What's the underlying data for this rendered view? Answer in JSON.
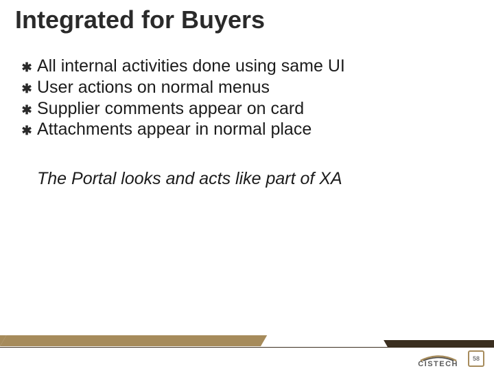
{
  "title": "Integrated for Buyers",
  "bullets": [
    "All internal activities done using same UI",
    "User actions on normal menus",
    "Supplier comments appear on card",
    "Attachments appear in normal place"
  ],
  "tagline": "The Portal looks and acts like part of XA",
  "logo_text": "CISTECH",
  "page_number": "58",
  "colors": {
    "tan": "#a68b5b",
    "dark": "#3a2e1f"
  }
}
